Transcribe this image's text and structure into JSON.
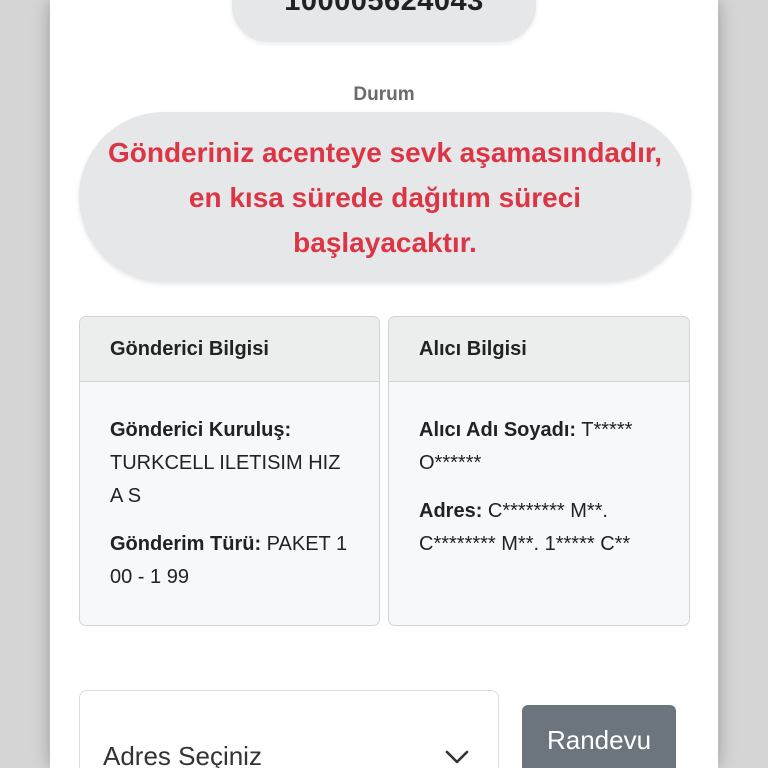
{
  "tracking": {
    "number": "100005624043"
  },
  "status": {
    "label": "Durum",
    "message": "Gönderiniz acenteye sevk aşamasındadır, en kısa sürede dağıtım süreci başlayacaktır."
  },
  "sender": {
    "title": "Gönderici Bilgisi",
    "institution_label": "Gönderici Kuruluş:",
    "institution_value": "TURKCELL ILETISIM HIZ A S",
    "type_label": "Gönderim Türü:",
    "type_value": "PAKET 1 00 - 1 99"
  },
  "receiver": {
    "title": "Alıcı Bilgisi",
    "name_label": "Alıcı Adı Soyadı:",
    "name_value": "T***** O******",
    "address_label": "Adres:",
    "address_value": "C******** M**. C******** M**. 1***** C**"
  },
  "controls": {
    "address_select_label": "Adres Seçiniz",
    "appointment_button_label": "Randevu"
  },
  "colors": {
    "status_text": "#dc3545",
    "button_bg": "#6c757d",
    "pill_bg": "#e6e7e9"
  },
  "icons": {
    "select_chevron": "chevron-down-icon"
  }
}
